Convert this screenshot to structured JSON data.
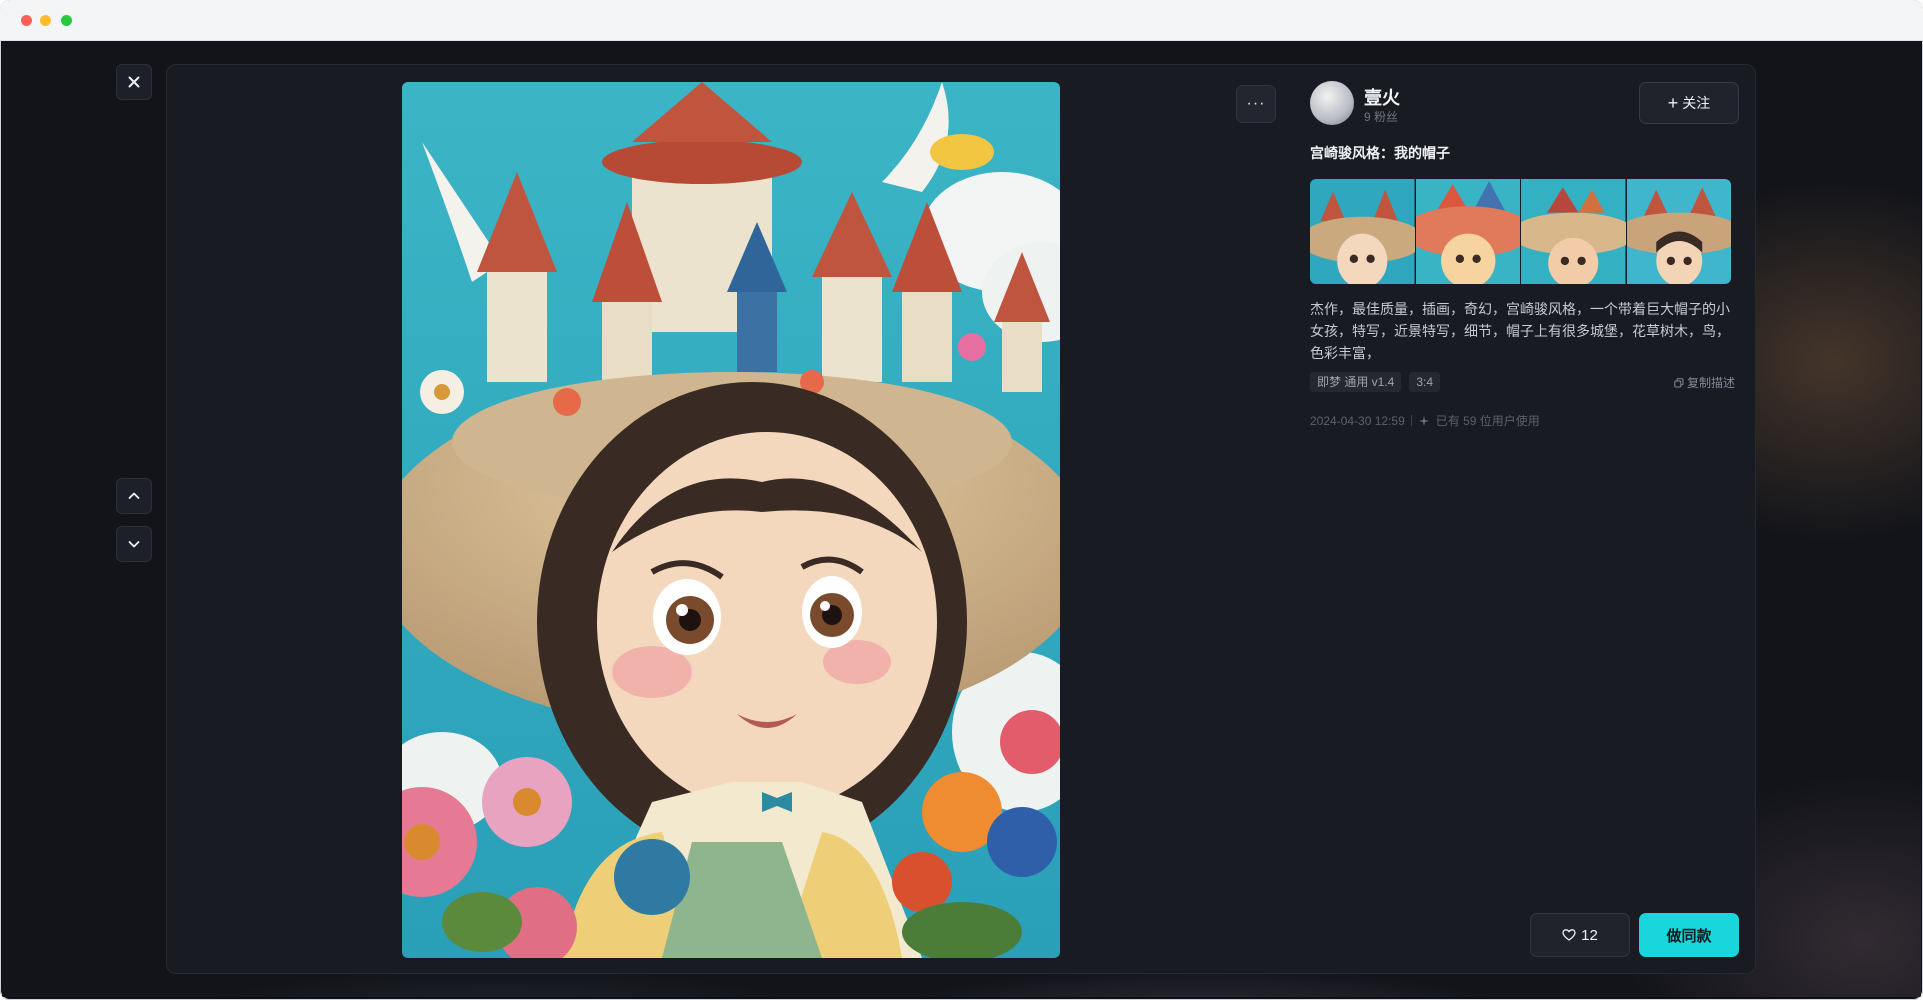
{
  "window": {
    "controls": [
      "close",
      "minimize",
      "maximize"
    ]
  },
  "nav": {
    "close_icon": "close-icon",
    "prev_icon": "chevron-up-icon",
    "next_icon": "chevron-down-icon"
  },
  "artwork": {
    "menu_label": "···"
  },
  "author": {
    "name": "壹火",
    "fans": "9 粉丝",
    "follow_label": "关注",
    "follow_icon": "plus-icon"
  },
  "work": {
    "title": "宫崎骏风格：我的帽子",
    "prompt": "杰作，最佳质量，插画，奇幻，宫崎骏风格，一个带着巨大帽子的小女孩，特写，近景特写，细节，帽子上有很多城堡，花草树木，鸟，色彩丰富，",
    "tags": [
      "即梦 通用 v1.4",
      "3:4"
    ],
    "copy_label": "复制描述",
    "date": "2024-04-30 12:59",
    "usage": "已有 59 位用户使用"
  },
  "actions": {
    "likes": "12",
    "make_label": "做同款"
  },
  "colors": {
    "accent": "#19d6dd",
    "panel": "#181b22",
    "background": "#12141a"
  }
}
